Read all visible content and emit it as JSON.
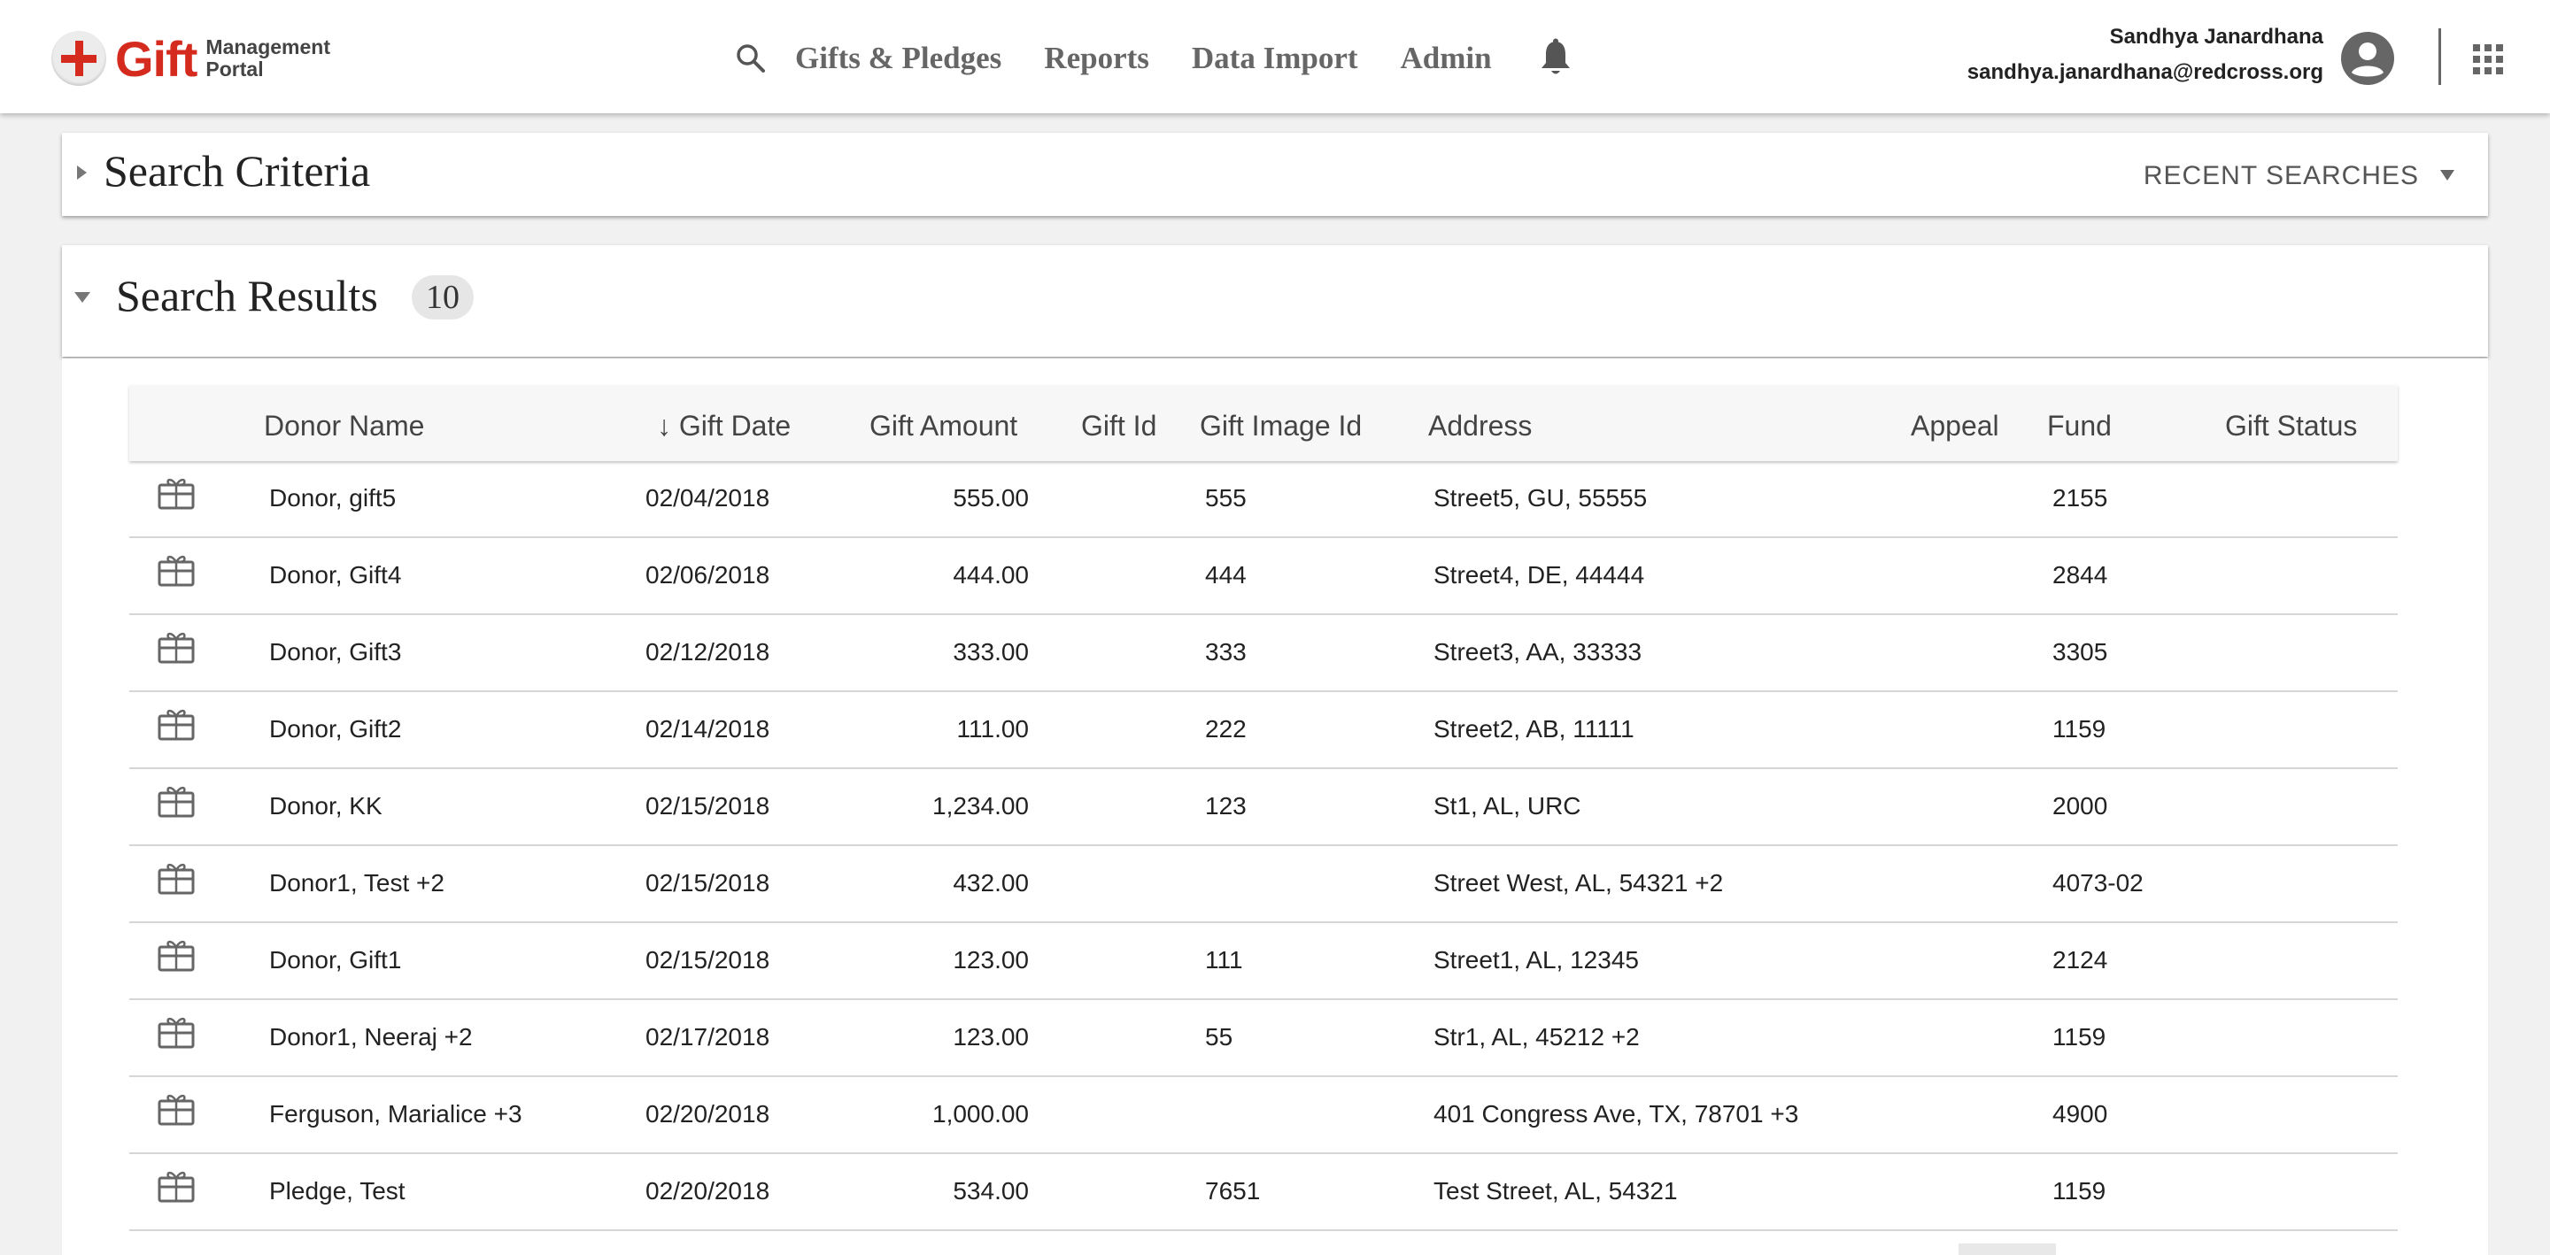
{
  "app": {
    "logo_word": "Gift",
    "logo_sub_1": "Management",
    "logo_sub_2": "Portal"
  },
  "nav": {
    "items": [
      "Gifts & Pledges",
      "Reports",
      "Data Import",
      "Admin"
    ]
  },
  "user": {
    "name": "Sandhya Janardhana",
    "email": "sandhya.janardhana@redcross.org"
  },
  "criteria": {
    "title": "Search Criteria",
    "recent_label": "RECENT SEARCHES"
  },
  "results": {
    "title": "Search Results",
    "count": "10",
    "columns": {
      "donor": "Donor Name",
      "date": "↓ Gift Date",
      "amount": "Gift Amount",
      "id": "Gift Id",
      "image": "Gift Image Id",
      "address": "Address",
      "appeal": "Appeal",
      "fund": "Fund",
      "status": "Gift Status"
    },
    "rows": [
      {
        "donor": "Donor, gift5",
        "date": "02/04/2018",
        "amount": "555.00",
        "image": "555",
        "address": "Street5, GU, 55555",
        "fund": "2155"
      },
      {
        "donor": "Donor, Gift4",
        "date": "02/06/2018",
        "amount": "444.00",
        "image": "444",
        "address": "Street4, DE, 44444",
        "fund": "2844"
      },
      {
        "donor": "Donor, Gift3",
        "date": "02/12/2018",
        "amount": "333.00",
        "image": "333",
        "address": "Street3, AA, 33333",
        "fund": "3305"
      },
      {
        "donor": "Donor, Gift2",
        "date": "02/14/2018",
        "amount": "111.00",
        "image": "222",
        "address": "Street2, AB, 11111",
        "fund": "1159"
      },
      {
        "donor": "Donor, KK",
        "date": "02/15/2018",
        "amount": "1,234.00",
        "image": "123",
        "address": "St1, AL, URC",
        "fund": "2000"
      },
      {
        "donor": "Donor1, Test +2",
        "date": "02/15/2018",
        "amount": "432.00",
        "image": "",
        "address": "Street West, AL, 54321 +2",
        "fund": "4073-02"
      },
      {
        "donor": "Donor, Gift1",
        "date": "02/15/2018",
        "amount": "123.00",
        "image": "111",
        "address": "Street1, AL, 12345",
        "fund": "2124"
      },
      {
        "donor": "Donor1, Neeraj +2",
        "date": "02/17/2018",
        "amount": "123.00",
        "image": "55",
        "address": "Str1, AL, 45212 +2",
        "fund": "1159"
      },
      {
        "donor": "Ferguson, Marialice +3",
        "date": "02/20/2018",
        "amount": "1,000.00",
        "image": "",
        "address": "401 Congress Ave, TX, 78701 +3",
        "fund": "4900"
      },
      {
        "donor": "Pledge, Test",
        "date": "02/20/2018",
        "amount": "534.00",
        "image": "7651",
        "address": "Test Street, AL, 54321",
        "fund": "1159"
      }
    ]
  }
}
